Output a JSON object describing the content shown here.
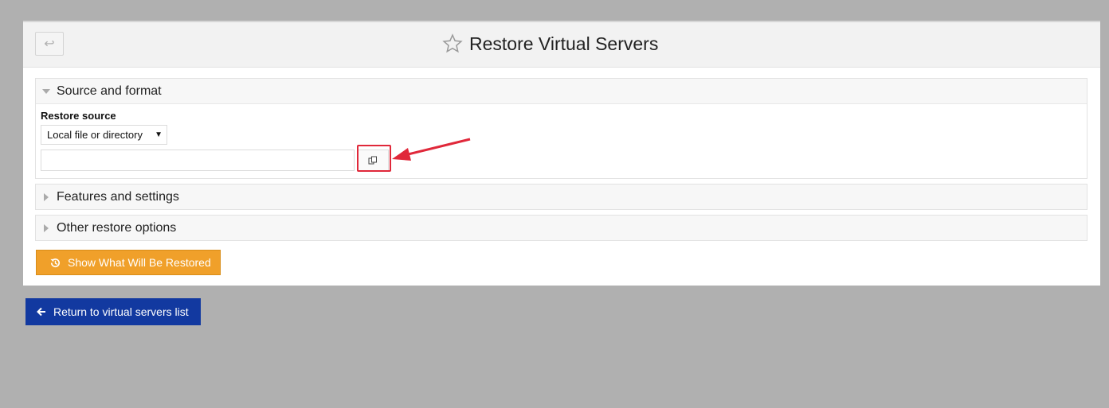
{
  "header": {
    "back_icon": "return-arrow-icon",
    "star_icon": "star-outline-icon",
    "title": "Restore Virtual Servers"
  },
  "sections": [
    {
      "label": "Source and format",
      "expanded": true
    },
    {
      "label": "Features and settings",
      "expanded": false
    },
    {
      "label": "Other restore options",
      "expanded": false
    }
  ],
  "restore_source": {
    "label": "Restore source",
    "selected": "Local file or directory",
    "path_value": "",
    "chooser_icon": "file-chooser-icon"
  },
  "actions": {
    "show_restore_label": "Show What Will Be Restored",
    "show_restore_icon": "history-icon",
    "return_label": "Return to virtual servers list",
    "return_icon": "arrow-left-icon"
  },
  "colors": {
    "annotation_red": "#e0283a",
    "restore_button": "#f0a02a",
    "return_button": "#1239a0"
  }
}
